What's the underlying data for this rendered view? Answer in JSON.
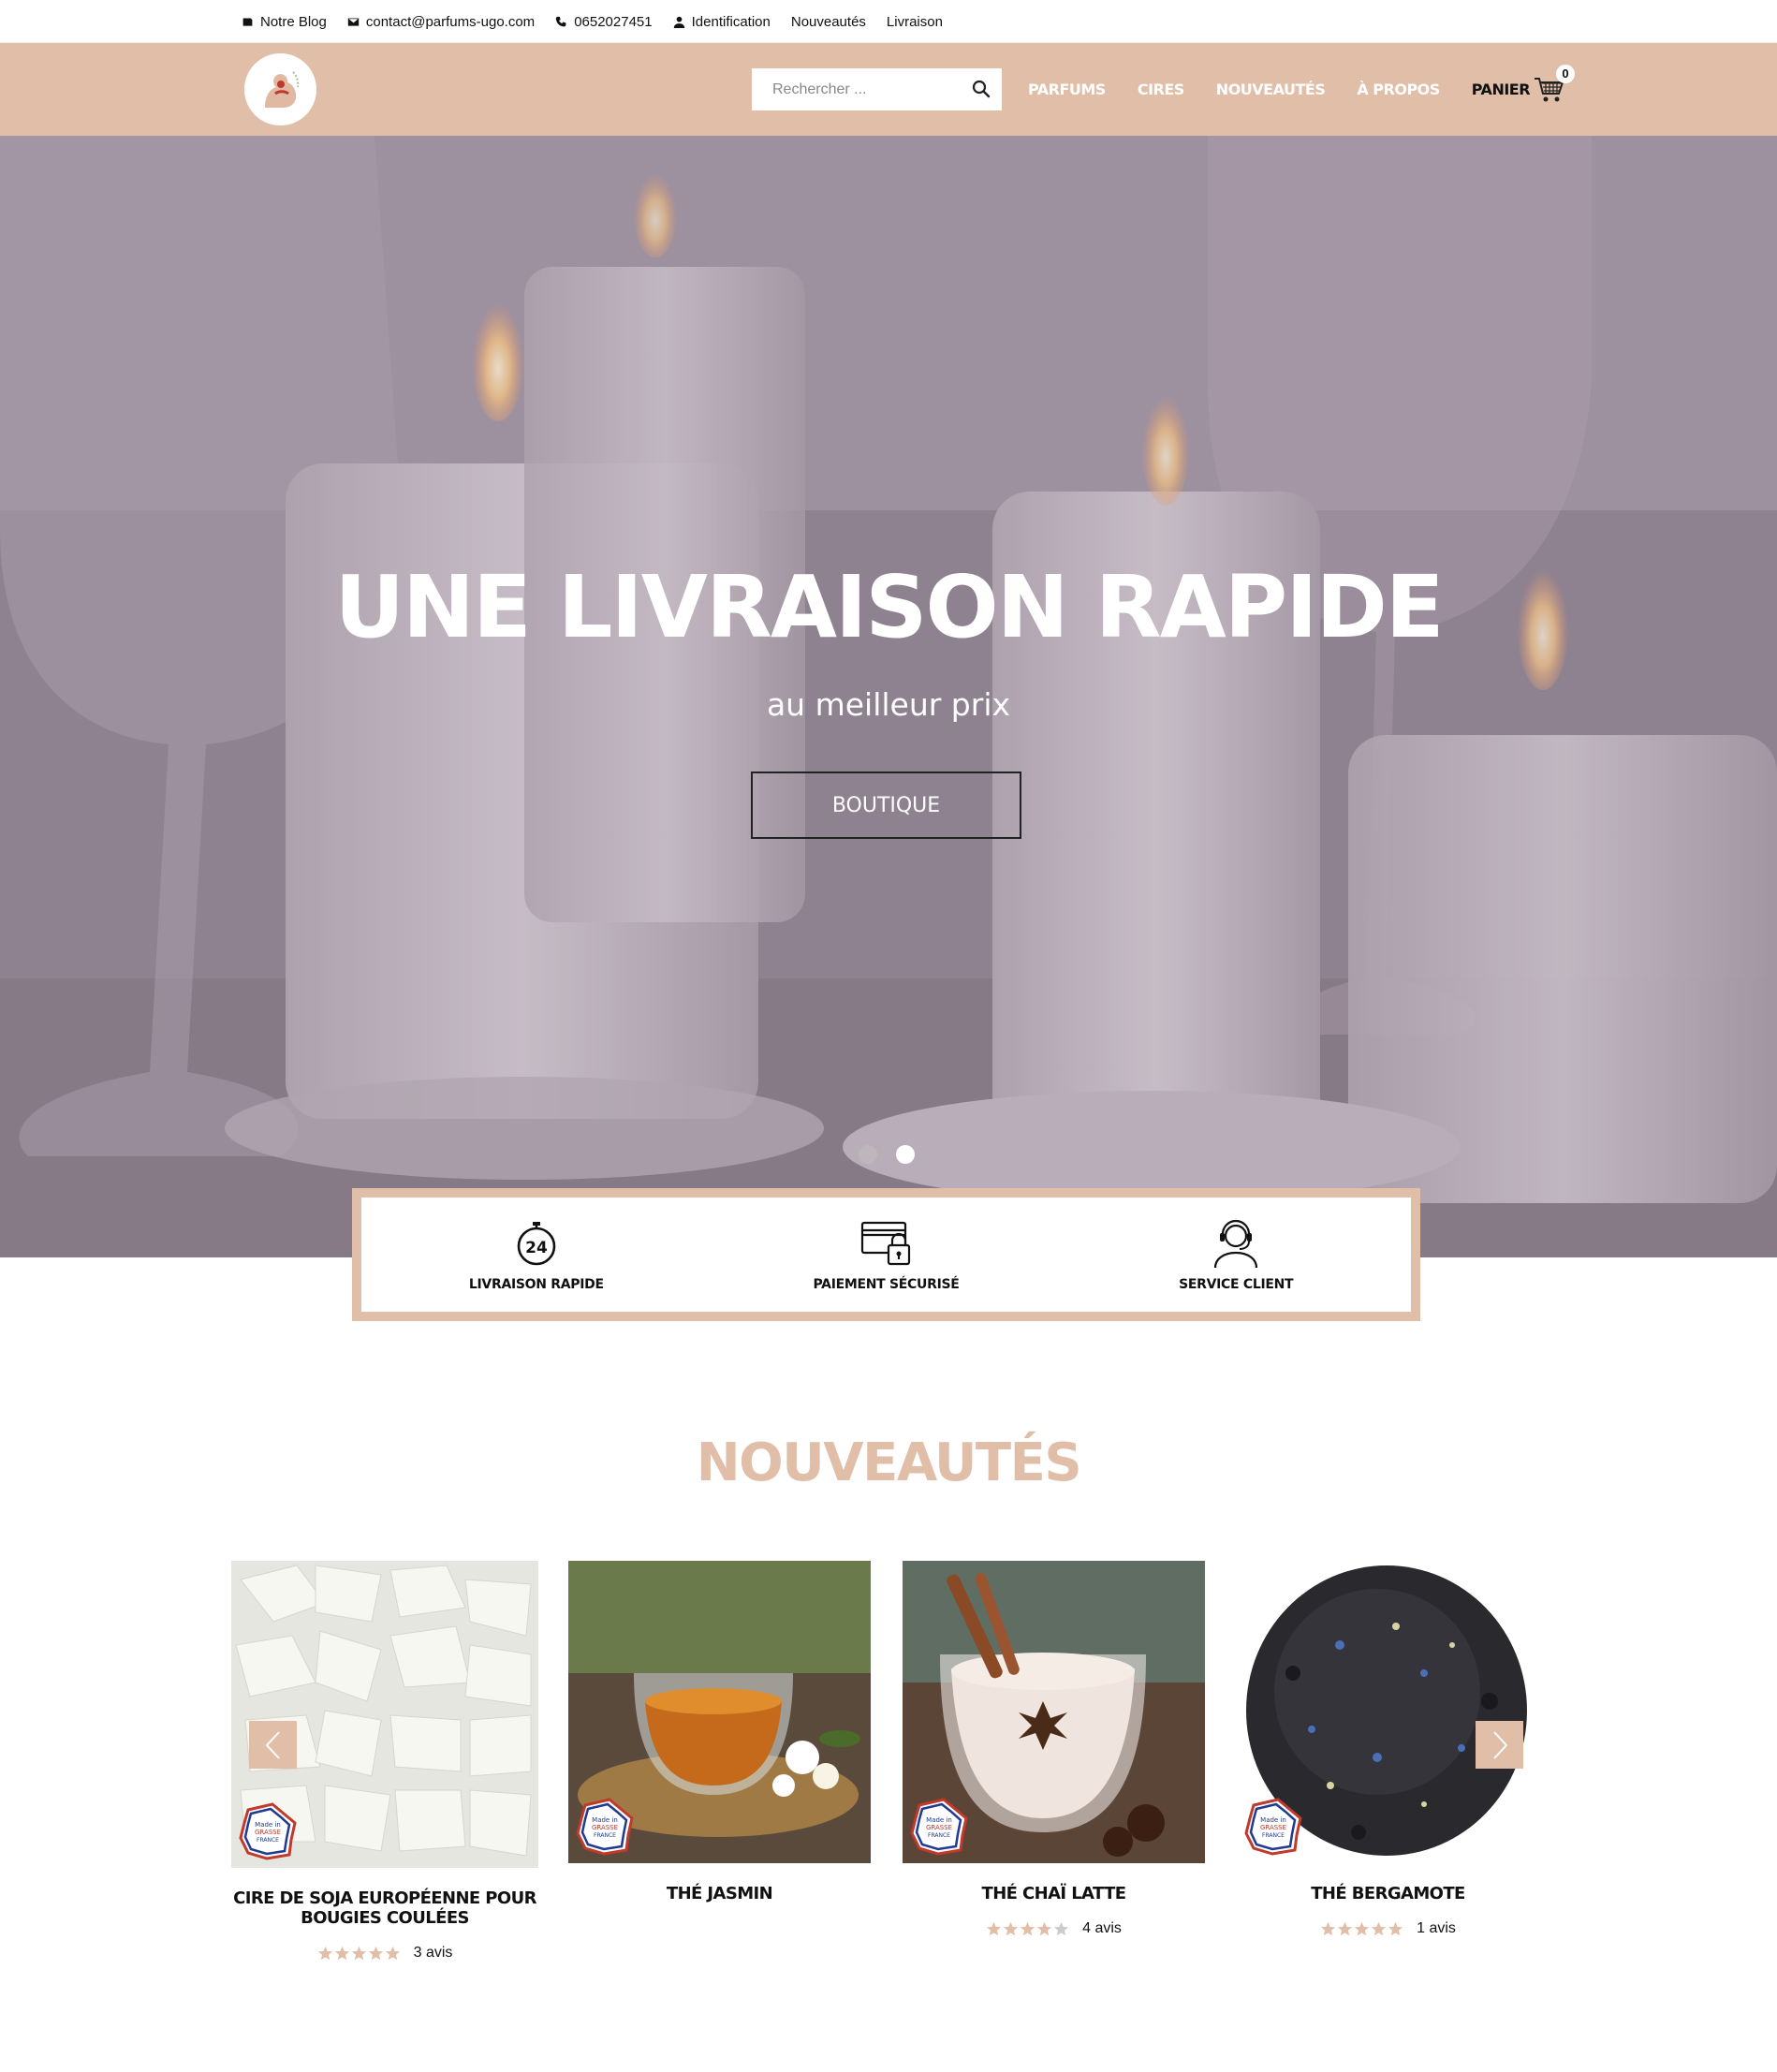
{
  "topbar": {
    "items": [
      {
        "label": "Notre Blog",
        "icon": "blog-icon"
      },
      {
        "label": "contact@parfums-ugo.com",
        "icon": "mail-icon"
      },
      {
        "label": "0652027451",
        "icon": "phone-icon"
      },
      {
        "label": "Identification",
        "icon": "user-icon"
      },
      {
        "label": "Nouveautés"
      },
      {
        "label": "Livraison"
      }
    ]
  },
  "header": {
    "search_placeholder": "Rechercher ...",
    "nav": [
      "PARFUMS",
      "CIRES",
      "NOUVEAUTÉS",
      "À PROPOS"
    ],
    "cart_label": "PANIER",
    "cart_count": "0"
  },
  "hero": {
    "title": "UNE LIVRAISON RAPIDE",
    "subtitle": "au meilleur prix",
    "button": "BOUTIQUE",
    "slides": 2,
    "active_slide": 2
  },
  "features": [
    {
      "label": "LIVRAISON RAPIDE",
      "icon": "stopwatch-24-icon",
      "icon_text": "24"
    },
    {
      "label": "PAIEMENT SÉCURISÉ",
      "icon": "secure-card-icon"
    },
    {
      "label": "SERVICE CLIENT",
      "icon": "headset-agent-icon"
    }
  ],
  "nouveautes": {
    "title": "NOUVEAUTÉS",
    "products": [
      {
        "name": "CIRE DE SOJA EUROPÉENNE POUR BOUGIES COULÉES",
        "rating": 5,
        "reviews": "3 avis"
      },
      {
        "name": "THÉ JASMIN",
        "rating": null,
        "reviews": ""
      },
      {
        "name": "THÉ CHAÏ LATTE",
        "rating": 4,
        "reviews": "4 avis"
      },
      {
        "name": "THÉ BERGAMOTE",
        "rating": 5,
        "reviews": "1 avis"
      }
    ],
    "badge_text": [
      "Made in",
      "GRASSE",
      "FRANCE"
    ]
  },
  "colors": {
    "accent": "#e0bea7",
    "text": "#111111",
    "star_filled": "#e0bea7",
    "star_empty": "#cccccc"
  }
}
